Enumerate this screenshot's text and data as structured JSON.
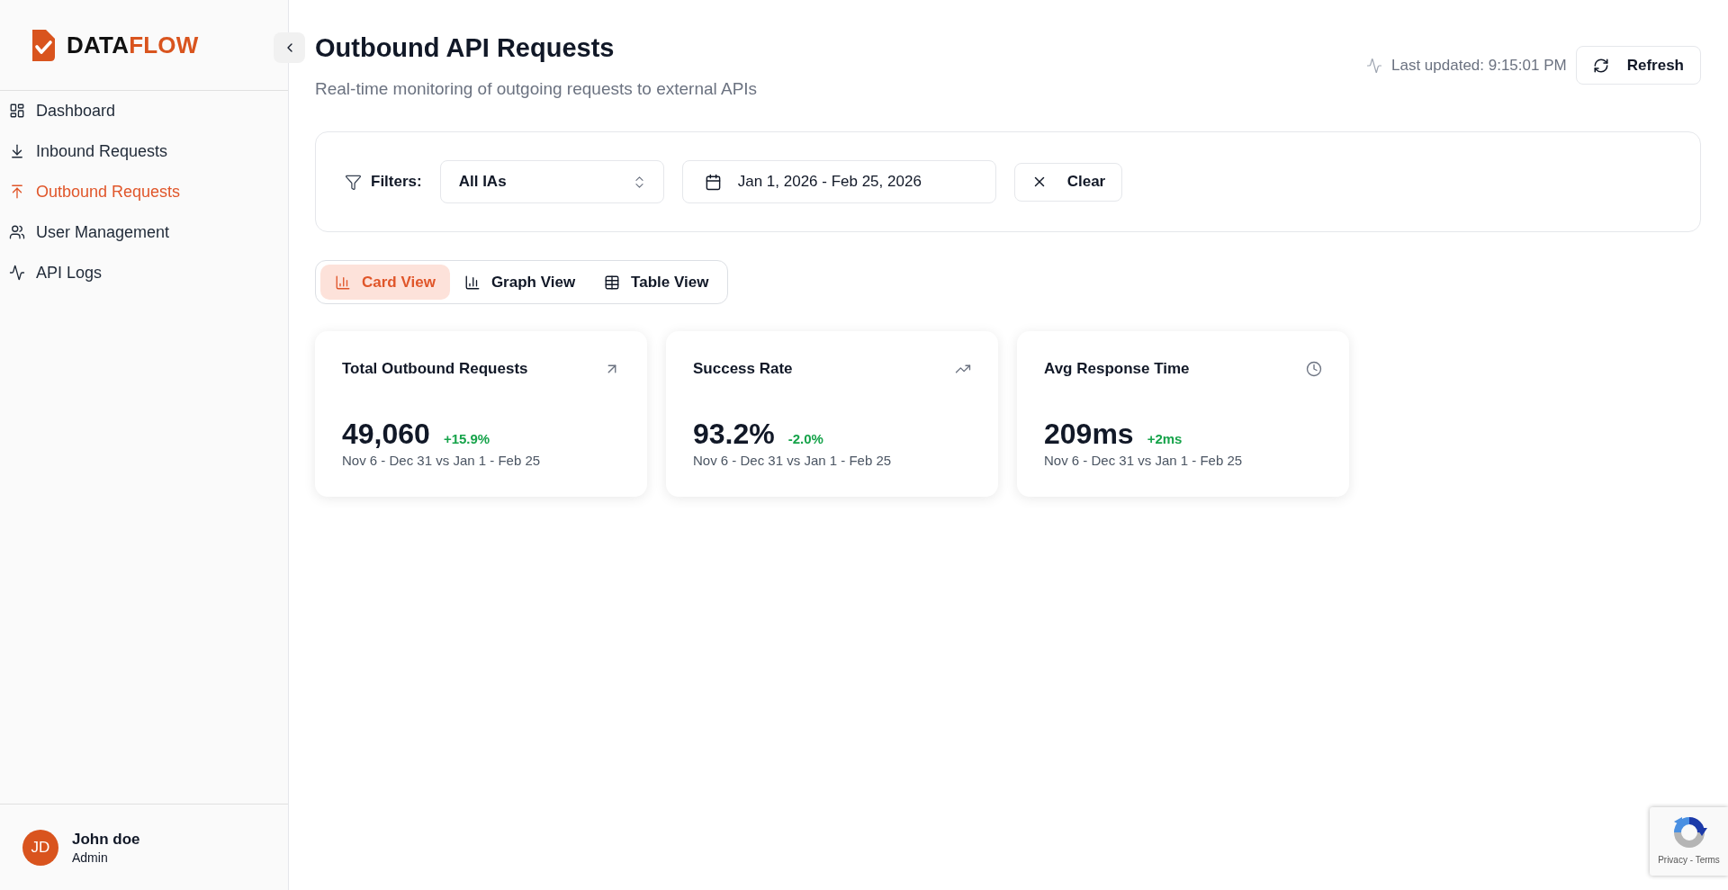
{
  "sidebar": {
    "logo": {
      "parts": [
        {
          "text": "DATA",
          "kind": "plain"
        },
        {
          "text": "FLOW",
          "kind": "accent"
        }
      ]
    },
    "nav_items": [
      {
        "label": "Dashboard",
        "selected": false
      },
      {
        "label": "Inbound Requests",
        "selected": false
      },
      {
        "label": "Outbound Requests",
        "selected": true
      },
      {
        "label": "User Management",
        "selected": false
      },
      {
        "label": "API Logs",
        "selected": false
      }
    ],
    "user": {
      "initials": "JD",
      "name": "John doe",
      "role": "Admin"
    }
  },
  "header": {
    "title": "Outbound API Requests",
    "subtitle": "Real-time monitoring of outgoing requests to external APIs",
    "last_updated": "Last updated: 9:15:01 PM",
    "refresh_button": "Refresh"
  },
  "filters": {
    "label": "Filters:",
    "ia_select": {
      "value": "All IAs"
    },
    "date_range": {
      "value": "Jan 1, 2026 - Feb 25, 2026"
    },
    "clear_button": "Clear"
  },
  "view_tabs": [
    {
      "label": "Card View",
      "selected": true
    },
    {
      "label": "Graph View",
      "selected": false
    },
    {
      "label": "Table View",
      "selected": false
    }
  ],
  "stat_cards": [
    {
      "title": "Total Outbound Requests",
      "value": "49,060",
      "change": "+15.9%",
      "comparison": "Nov 6 - Dec 31 vs Jan 1 - Feb 25"
    },
    {
      "title": "Success Rate",
      "value": "93.2%",
      "change": "-2.0%",
      "comparison": "Nov 6 - Dec 31 vs Jan 1 - Feb 25"
    },
    {
      "title": "Avg Response Time",
      "value": "209ms",
      "change": "+2ms",
      "comparison": "Nov 6 - Dec 31 vs Jan 1 - Feb 25"
    }
  ],
  "recaptcha": {
    "links": "Privacy - Terms"
  }
}
